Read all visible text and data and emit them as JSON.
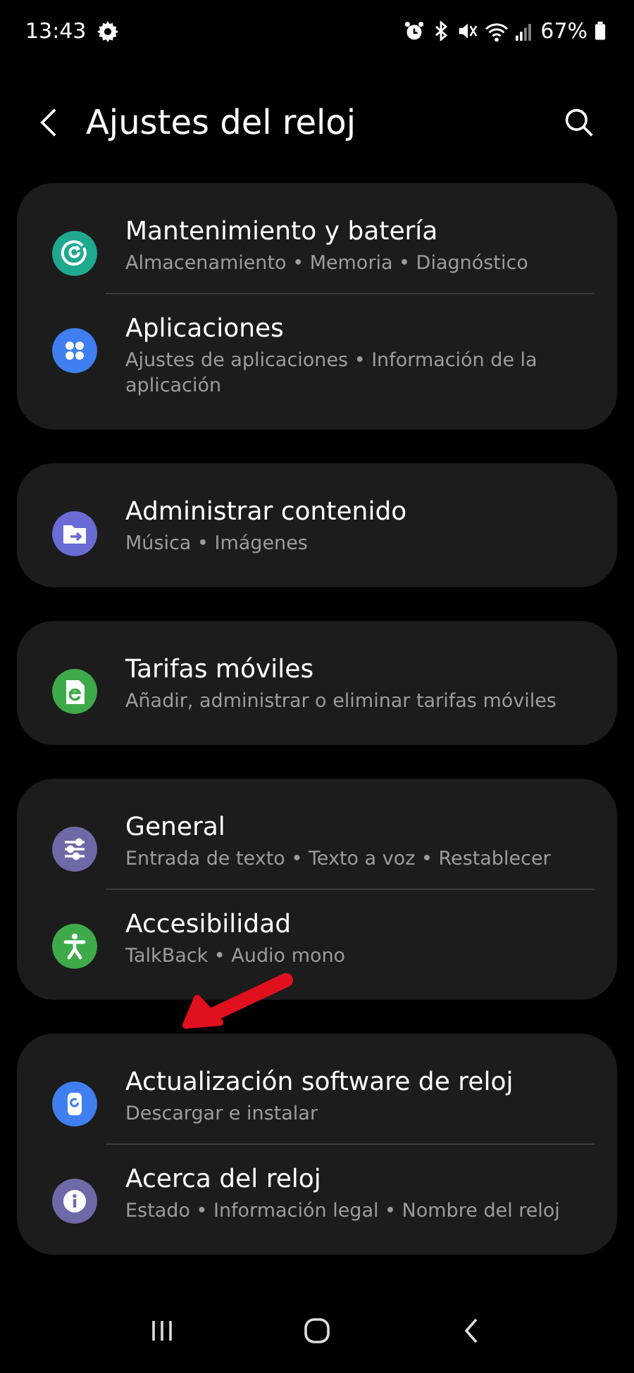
{
  "status_bar": {
    "time": "13:43",
    "battery": "67%"
  },
  "header": {
    "title": "Ajustes del reloj"
  },
  "groups": [
    {
      "items": [
        {
          "title": "Mantenimiento y batería",
          "subtitle": "Almacenamiento • Memoria • Diagnóstico",
          "color": "#1fa98f"
        },
        {
          "title": "Aplicaciones",
          "subtitle": "Ajustes de aplicaciones • Información de la aplicación",
          "color": "#3f7ff0"
        }
      ]
    },
    {
      "items": [
        {
          "title": "Administrar contenido",
          "subtitle": "Música • Imágenes",
          "color": "#6b6bd6"
        }
      ]
    },
    {
      "items": [
        {
          "title": "Tarifas móviles",
          "subtitle": "Añadir, administrar o eliminar tarifas móviles",
          "color": "#3faa4a"
        }
      ]
    },
    {
      "items": [
        {
          "title": "General",
          "subtitle": "Entrada de texto • Texto a voz • Restablecer",
          "color": "#6e6aa8"
        },
        {
          "title": "Accesibilidad",
          "subtitle": "TalkBack • Audio mono",
          "color": "#3faa4a"
        }
      ]
    },
    {
      "items": [
        {
          "title": "Actualización software de reloj",
          "subtitle": "Descargar e instalar",
          "color": "#3f7ff0"
        },
        {
          "title": "Acerca del reloj",
          "subtitle": "Estado • Información legal • Nombre del reloj",
          "color": "#6e6aa8"
        }
      ]
    }
  ]
}
